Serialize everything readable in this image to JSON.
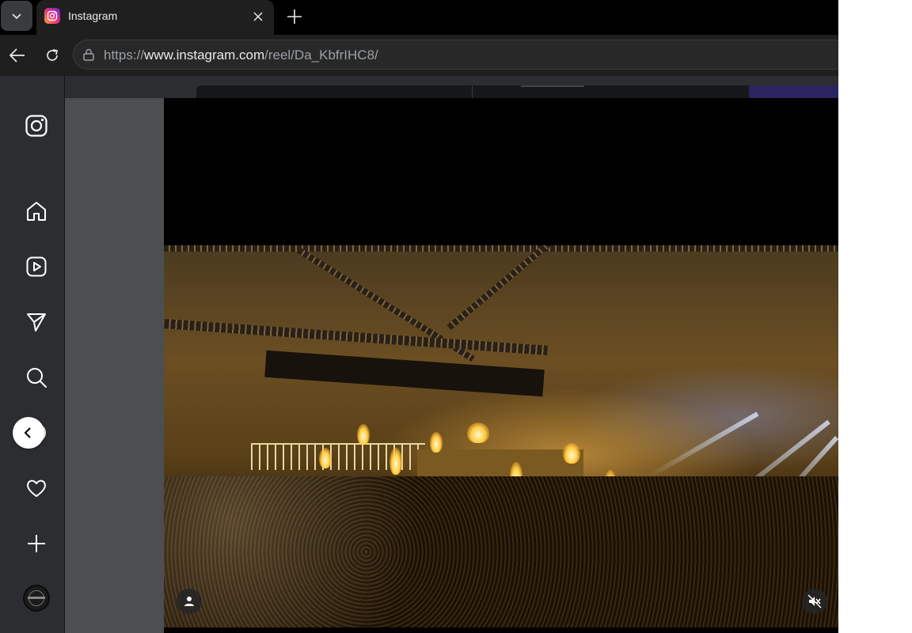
{
  "browser": {
    "tab": {
      "title": "Instagram",
      "favicon": "instagram-favicon",
      "brand_gradient": [
        "#f9a43a",
        "#ee2a7b",
        "#6228d7"
      ]
    },
    "address": {
      "protocol": "https://",
      "host": "www.instagram.com",
      "path": "/reel/Da_KbfrIHC8/"
    }
  },
  "sidebar": {
    "items": [
      {
        "icon": "instagram-logo-icon"
      },
      {
        "icon": "home-icon"
      },
      {
        "icon": "reels-icon"
      },
      {
        "icon": "messages-icon"
      },
      {
        "icon": "search-icon"
      },
      {
        "icon": "explore-icon"
      },
      {
        "icon": "notifications-heart-icon"
      },
      {
        "icon": "create-plus-icon"
      },
      {
        "icon": "profile-avatar"
      }
    ]
  },
  "viewer": {
    "previous_button": "chevron-left-icon",
    "video": {
      "muted": true,
      "tagged_users_icon": "user-icon",
      "mute_icon": "speaker-muted-icon"
    }
  }
}
